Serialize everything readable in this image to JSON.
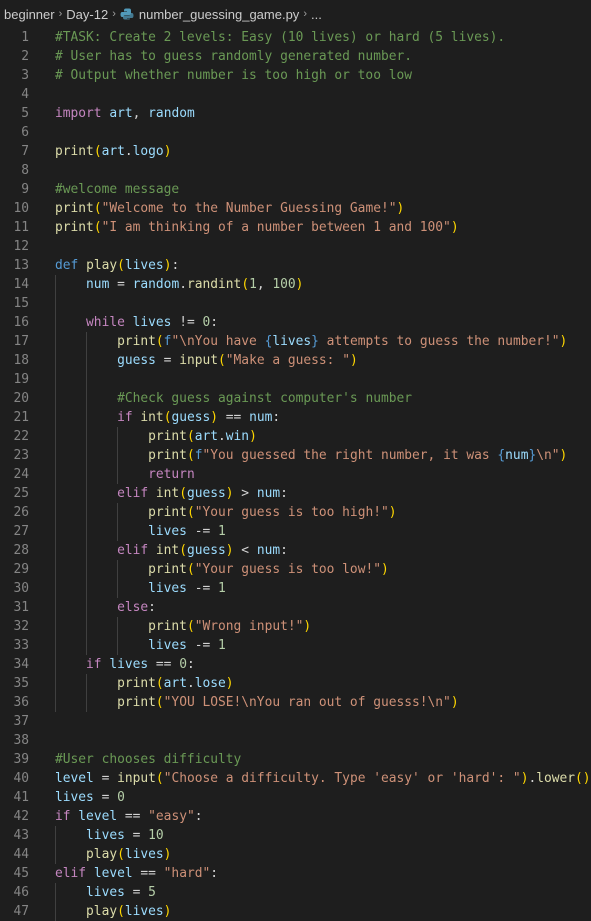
{
  "breadcrumb": {
    "items": [
      "beginner",
      "Day-12",
      "number_guessing_game.py",
      "..."
    ],
    "separator": "›"
  },
  "editor": {
    "lines": [
      {
        "n": "1",
        "indent": 0,
        "t": [
          [
            "cm",
            "#TASK: Create 2 levels: Easy (10 lives) or hard (5 lives)."
          ]
        ]
      },
      {
        "n": "2",
        "indent": 0,
        "t": [
          [
            "cm",
            "# User has to guess randomly generated number."
          ]
        ]
      },
      {
        "n": "3",
        "indent": 0,
        "t": [
          [
            "cm",
            "# Output whether number is too high or too low"
          ]
        ]
      },
      {
        "n": "4",
        "indent": 0,
        "t": []
      },
      {
        "n": "5",
        "indent": 0,
        "t": [
          [
            "kw",
            "import"
          ],
          [
            "plain",
            " "
          ],
          [
            "var",
            "art"
          ],
          [
            "plain",
            ", "
          ],
          [
            "var",
            "random"
          ]
        ]
      },
      {
        "n": "6",
        "indent": 0,
        "t": []
      },
      {
        "n": "7",
        "indent": 0,
        "t": [
          [
            "fn",
            "print"
          ],
          [
            "p1",
            "("
          ],
          [
            "var",
            "art"
          ],
          [
            "plain",
            "."
          ],
          [
            "var",
            "logo"
          ],
          [
            "p1",
            ")"
          ]
        ]
      },
      {
        "n": "8",
        "indent": 0,
        "t": []
      },
      {
        "n": "9",
        "indent": 0,
        "t": [
          [
            "cm",
            "#welcome message"
          ]
        ]
      },
      {
        "n": "10",
        "indent": 0,
        "t": [
          [
            "fn",
            "print"
          ],
          [
            "p1",
            "("
          ],
          [
            "str",
            "\"Welcome to the Number Guessing Game!\""
          ],
          [
            "p1",
            ")"
          ]
        ]
      },
      {
        "n": "11",
        "indent": 0,
        "t": [
          [
            "fn",
            "print"
          ],
          [
            "p1",
            "("
          ],
          [
            "str",
            "\"I am thinking of a number between 1 and 100\""
          ],
          [
            "p1",
            ")"
          ]
        ]
      },
      {
        "n": "12",
        "indent": 0,
        "t": []
      },
      {
        "n": "13",
        "indent": 0,
        "t": [
          [
            "kwb",
            "def"
          ],
          [
            "plain",
            " "
          ],
          [
            "fn",
            "play"
          ],
          [
            "p1",
            "("
          ],
          [
            "var",
            "lives"
          ],
          [
            "p1",
            ")"
          ],
          [
            "plain",
            ":"
          ]
        ]
      },
      {
        "n": "14",
        "indent": 1,
        "t": [
          [
            "var",
            "num"
          ],
          [
            "plain",
            " = "
          ],
          [
            "var",
            "random"
          ],
          [
            "plain",
            "."
          ],
          [
            "fn",
            "randint"
          ],
          [
            "p1",
            "("
          ],
          [
            "num",
            "1"
          ],
          [
            "plain",
            ", "
          ],
          [
            "num",
            "100"
          ],
          [
            "p1",
            ")"
          ]
        ]
      },
      {
        "n": "15",
        "indent": 1,
        "t": []
      },
      {
        "n": "16",
        "indent": 1,
        "t": [
          [
            "kw",
            "while"
          ],
          [
            "plain",
            " "
          ],
          [
            "var",
            "lives"
          ],
          [
            "plain",
            " != "
          ],
          [
            "num",
            "0"
          ],
          [
            "plain",
            ":"
          ]
        ]
      },
      {
        "n": "17",
        "indent": 2,
        "t": [
          [
            "fn",
            "print"
          ],
          [
            "p1",
            "("
          ],
          [
            "kwb",
            "f"
          ],
          [
            "str",
            "\"\\nYou have "
          ],
          [
            "kwb",
            "{"
          ],
          [
            "var",
            "lives"
          ],
          [
            "kwb",
            "}"
          ],
          [
            "str",
            " attempts to guess the number!\""
          ],
          [
            "p1",
            ")"
          ]
        ]
      },
      {
        "n": "18",
        "indent": 2,
        "t": [
          [
            "var",
            "guess"
          ],
          [
            "plain",
            " = "
          ],
          [
            "fn",
            "input"
          ],
          [
            "p1",
            "("
          ],
          [
            "str",
            "\"Make a guess: \""
          ],
          [
            "p1",
            ")"
          ]
        ]
      },
      {
        "n": "19",
        "indent": 2,
        "t": []
      },
      {
        "n": "20",
        "indent": 2,
        "t": [
          [
            "cm",
            "#Check guess against computer's number"
          ]
        ]
      },
      {
        "n": "21",
        "indent": 2,
        "t": [
          [
            "kw",
            "if"
          ],
          [
            "plain",
            " "
          ],
          [
            "fn",
            "int"
          ],
          [
            "p1",
            "("
          ],
          [
            "var",
            "guess"
          ],
          [
            "p1",
            ")"
          ],
          [
            "plain",
            " == "
          ],
          [
            "var",
            "num"
          ],
          [
            "plain",
            ":"
          ]
        ]
      },
      {
        "n": "22",
        "indent": 3,
        "t": [
          [
            "fn",
            "print"
          ],
          [
            "p1",
            "("
          ],
          [
            "var",
            "art"
          ],
          [
            "plain",
            "."
          ],
          [
            "var",
            "win"
          ],
          [
            "p1",
            ")"
          ]
        ]
      },
      {
        "n": "23",
        "indent": 3,
        "t": [
          [
            "fn",
            "print"
          ],
          [
            "p1",
            "("
          ],
          [
            "kwb",
            "f"
          ],
          [
            "str",
            "\"You guessed the right number, it was "
          ],
          [
            "kwb",
            "{"
          ],
          [
            "var",
            "num"
          ],
          [
            "kwb",
            "}"
          ],
          [
            "str",
            "\\n\""
          ],
          [
            "p1",
            ")"
          ]
        ]
      },
      {
        "n": "24",
        "indent": 3,
        "t": [
          [
            "kw",
            "return"
          ]
        ]
      },
      {
        "n": "25",
        "indent": 2,
        "t": [
          [
            "kw",
            "elif"
          ],
          [
            "plain",
            " "
          ],
          [
            "fn",
            "int"
          ],
          [
            "p1",
            "("
          ],
          [
            "var",
            "guess"
          ],
          [
            "p1",
            ")"
          ],
          [
            "plain",
            " > "
          ],
          [
            "var",
            "num"
          ],
          [
            "plain",
            ":"
          ]
        ]
      },
      {
        "n": "26",
        "indent": 3,
        "t": [
          [
            "fn",
            "print"
          ],
          [
            "p1",
            "("
          ],
          [
            "str",
            "\"Your guess is too high!\""
          ],
          [
            "p1",
            ")"
          ]
        ]
      },
      {
        "n": "27",
        "indent": 3,
        "t": [
          [
            "var",
            "lives"
          ],
          [
            "plain",
            " -= "
          ],
          [
            "num",
            "1"
          ]
        ]
      },
      {
        "n": "28",
        "indent": 2,
        "t": [
          [
            "kw",
            "elif"
          ],
          [
            "plain",
            " "
          ],
          [
            "fn",
            "int"
          ],
          [
            "p1",
            "("
          ],
          [
            "var",
            "guess"
          ],
          [
            "p1",
            ")"
          ],
          [
            "plain",
            " < "
          ],
          [
            "var",
            "num"
          ],
          [
            "plain",
            ":"
          ]
        ]
      },
      {
        "n": "29",
        "indent": 3,
        "t": [
          [
            "fn",
            "print"
          ],
          [
            "p1",
            "("
          ],
          [
            "str",
            "\"Your guess is too low!\""
          ],
          [
            "p1",
            ")"
          ]
        ]
      },
      {
        "n": "30",
        "indent": 3,
        "t": [
          [
            "var",
            "lives"
          ],
          [
            "plain",
            " -= "
          ],
          [
            "num",
            "1"
          ]
        ]
      },
      {
        "n": "31",
        "indent": 2,
        "t": [
          [
            "kw",
            "else"
          ],
          [
            "plain",
            ":"
          ]
        ]
      },
      {
        "n": "32",
        "indent": 3,
        "t": [
          [
            "fn",
            "print"
          ],
          [
            "p1",
            "("
          ],
          [
            "str",
            "\"Wrong input!\""
          ],
          [
            "p1",
            ")"
          ]
        ]
      },
      {
        "n": "33",
        "indent": 3,
        "t": [
          [
            "var",
            "lives"
          ],
          [
            "plain",
            " -= "
          ],
          [
            "num",
            "1"
          ]
        ]
      },
      {
        "n": "34",
        "indent": 1,
        "t": [
          [
            "kw",
            "if"
          ],
          [
            "plain",
            " "
          ],
          [
            "var",
            "lives"
          ],
          [
            "plain",
            " == "
          ],
          [
            "num",
            "0"
          ],
          [
            "plain",
            ":"
          ]
        ]
      },
      {
        "n": "35",
        "indent": 2,
        "t": [
          [
            "fn",
            "print"
          ],
          [
            "p1",
            "("
          ],
          [
            "var",
            "art"
          ],
          [
            "plain",
            "."
          ],
          [
            "var",
            "lose"
          ],
          [
            "p1",
            ")"
          ]
        ]
      },
      {
        "n": "36",
        "indent": 2,
        "t": [
          [
            "fn",
            "print"
          ],
          [
            "p1",
            "("
          ],
          [
            "str",
            "\"YOU LOSE!\\nYou ran out of guesss!\\n\""
          ],
          [
            "p1",
            ")"
          ]
        ]
      },
      {
        "n": "37",
        "indent": 0,
        "t": []
      },
      {
        "n": "38",
        "indent": 0,
        "t": []
      },
      {
        "n": "39",
        "indent": 0,
        "t": [
          [
            "cm",
            "#User chooses difficulty"
          ]
        ]
      },
      {
        "n": "40",
        "indent": 0,
        "t": [
          [
            "var",
            "level"
          ],
          [
            "plain",
            " = "
          ],
          [
            "fn",
            "input"
          ],
          [
            "p1",
            "("
          ],
          [
            "str",
            "\"Choose a difficulty. Type 'easy' or 'hard': \""
          ],
          [
            "p1",
            ")"
          ],
          [
            "plain",
            "."
          ],
          [
            "fn",
            "lower"
          ],
          [
            "p1",
            "()"
          ]
        ]
      },
      {
        "n": "41",
        "indent": 0,
        "t": [
          [
            "var",
            "lives"
          ],
          [
            "plain",
            " = "
          ],
          [
            "num",
            "0"
          ]
        ]
      },
      {
        "n": "42",
        "indent": 0,
        "t": [
          [
            "kw",
            "if"
          ],
          [
            "plain",
            " "
          ],
          [
            "var",
            "level"
          ],
          [
            "plain",
            " == "
          ],
          [
            "str",
            "\"easy\""
          ],
          [
            "plain",
            ":"
          ]
        ]
      },
      {
        "n": "43",
        "indent": 1,
        "t": [
          [
            "var",
            "lives"
          ],
          [
            "plain",
            " = "
          ],
          [
            "num",
            "10"
          ]
        ]
      },
      {
        "n": "44",
        "indent": 1,
        "t": [
          [
            "fn",
            "play"
          ],
          [
            "p1",
            "("
          ],
          [
            "var",
            "lives"
          ],
          [
            "p1",
            ")"
          ]
        ]
      },
      {
        "n": "45",
        "indent": 0,
        "t": [
          [
            "kw",
            "elif"
          ],
          [
            "plain",
            " "
          ],
          [
            "var",
            "level"
          ],
          [
            "plain",
            " == "
          ],
          [
            "str",
            "\"hard\""
          ],
          [
            "plain",
            ":"
          ]
        ]
      },
      {
        "n": "46",
        "indent": 1,
        "t": [
          [
            "var",
            "lives"
          ],
          [
            "plain",
            " = "
          ],
          [
            "num",
            "5"
          ]
        ]
      },
      {
        "n": "47",
        "indent": 1,
        "t": [
          [
            "fn",
            "play"
          ],
          [
            "p1",
            "("
          ],
          [
            "var",
            "lives"
          ],
          [
            "p1",
            ")"
          ]
        ]
      }
    ]
  }
}
